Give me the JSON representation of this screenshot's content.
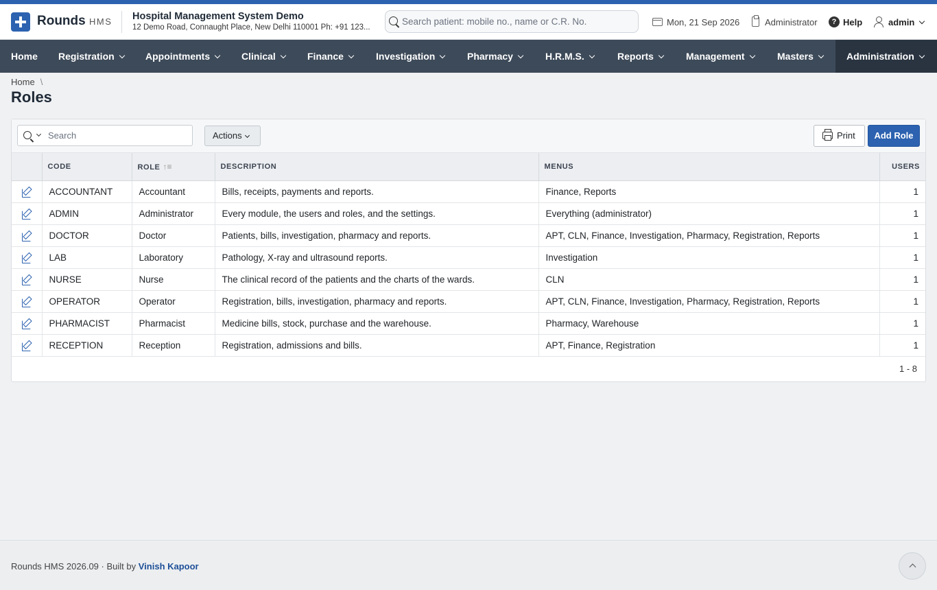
{
  "colors": {
    "accent": "#2c62b0",
    "nav_bg": "#3d4a59",
    "nav_active_bg": "#2a3441"
  },
  "header": {
    "brand": "Rounds",
    "brand_sub": "HMS",
    "hospital_name": "Hospital Management System Demo",
    "hospital_address": "12 Demo Road, Connaught Place, New Delhi 110001 Ph: +91 123...",
    "search_placeholder": "Search patient: mobile no., name or C.R. No.",
    "date": "Mon, 21 Sep 2026",
    "role": "Administrator",
    "help": "Help",
    "user": "admin",
    "icons": [
      "search-icon",
      "calendar-icon",
      "clipboard-icon",
      "help-icon",
      "user-icon"
    ]
  },
  "nav": {
    "items": [
      {
        "label": "Home"
      },
      {
        "label": "Registration"
      },
      {
        "label": "Appointments"
      },
      {
        "label": "Clinical"
      },
      {
        "label": "Finance"
      },
      {
        "label": "Investigation"
      },
      {
        "label": "Pharmacy"
      },
      {
        "label": "H.R.M.S."
      },
      {
        "label": "Reports"
      },
      {
        "label": "Management"
      },
      {
        "label": "Masters"
      },
      {
        "label": "Administration",
        "active": true
      }
    ]
  },
  "breadcrumb": {
    "home": "Home",
    "separator": "\\"
  },
  "page": {
    "title": "Roles"
  },
  "toolbar": {
    "search_placeholder": "Search",
    "actions_label": "Actions",
    "print_label": "Print",
    "add_label": "Add Role"
  },
  "table": {
    "columns": {
      "code": "CODE",
      "role": "ROLE",
      "description": "DESCRIPTION",
      "menus": "MENUS",
      "users": "USERS"
    },
    "rows": [
      {
        "code": "ACCOUNTANT",
        "role": "Accountant",
        "description": "Bills, receipts, payments and reports.",
        "menus": "Finance, Reports",
        "users": "1"
      },
      {
        "code": "ADMIN",
        "role": "Administrator",
        "description": "Every module, the users and roles, and the settings.",
        "menus": "Everything (administrator)",
        "users": "1"
      },
      {
        "code": "DOCTOR",
        "role": "Doctor",
        "description": "Patients, bills, investigation, pharmacy and reports.",
        "menus": "APT, CLN, Finance, Investigation, Pharmacy, Registration, Reports",
        "users": "1"
      },
      {
        "code": "LAB",
        "role": "Laboratory",
        "description": "Pathology, X-ray and ultrasound reports.",
        "menus": "Investigation",
        "users": "1"
      },
      {
        "code": "NURSE",
        "role": "Nurse",
        "description": "The clinical record of the patients and the charts of the wards.",
        "menus": "CLN",
        "users": "1"
      },
      {
        "code": "OPERATOR",
        "role": "Operator",
        "description": "Registration, bills, investigation, pharmacy and reports.",
        "menus": "APT, CLN, Finance, Investigation, Pharmacy, Registration, Reports",
        "users": "1"
      },
      {
        "code": "PHARMACIST",
        "role": "Pharmacist",
        "description": "Medicine bills, stock, purchase and the warehouse.",
        "menus": "Pharmacy, Warehouse",
        "users": "1"
      },
      {
        "code": "RECEPTION",
        "role": "Reception",
        "description": "Registration, admissions and bills.",
        "menus": "APT, Finance, Registration",
        "users": "1"
      }
    ],
    "pager": "1 - 8"
  },
  "footer": {
    "text": "Rounds HMS 2026.09 · Built by",
    "author": "Vinish Kapoor"
  }
}
